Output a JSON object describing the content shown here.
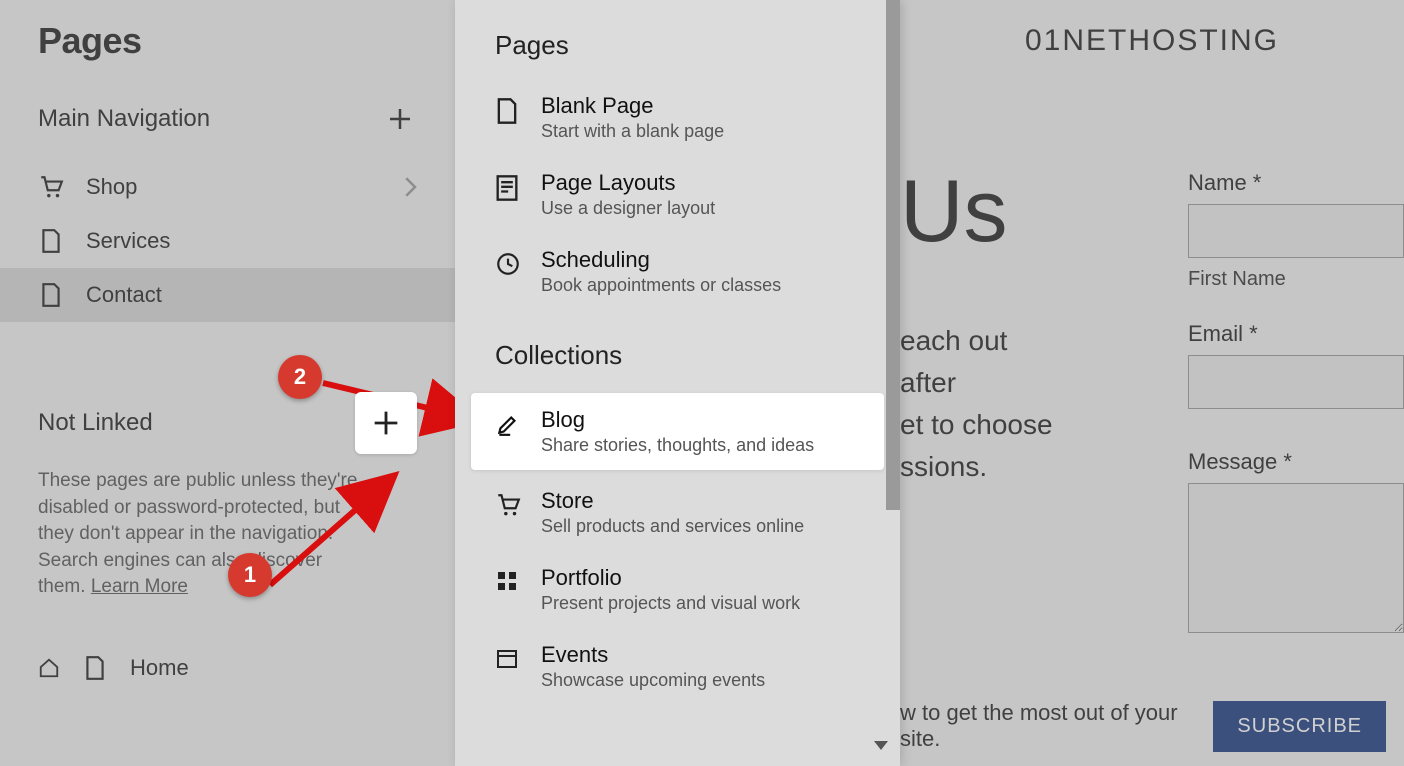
{
  "sidebar": {
    "title": "Pages",
    "main_nav_label": "Main Navigation",
    "nav_items": [
      {
        "label": "Shop"
      },
      {
        "label": "Services"
      },
      {
        "label": "Contact"
      }
    ],
    "not_linked_label": "Not Linked",
    "not_linked_desc_1": "These pages are public unless they're disabled or password-protected, but they don't appear in the navigation. Search engines can also discover them. ",
    "not_linked_learn": "Learn More",
    "home_label": "Home"
  },
  "popup": {
    "section_pages": "Pages",
    "section_collections": "Collections",
    "items_pages": [
      {
        "title": "Blank Page",
        "sub": "Start with a blank page"
      },
      {
        "title": "Page Layouts",
        "sub": "Use a designer layout"
      },
      {
        "title": "Scheduling",
        "sub": "Book appointments or classes"
      }
    ],
    "items_collections": [
      {
        "title": "Blog",
        "sub": "Share stories, thoughts, and ideas"
      },
      {
        "title": "Store",
        "sub": "Sell products and services online"
      },
      {
        "title": "Portfolio",
        "sub": "Present projects and visual work"
      },
      {
        "title": "Events",
        "sub": "Showcase upcoming events"
      }
    ]
  },
  "preview": {
    "brand": "01NETHOSTING",
    "hero_peek": "Us",
    "body_lines": "each out\nafter\net to choose\nssions.",
    "form": {
      "name_label": "Name *",
      "first_name_label": "First Name",
      "email_label": "Email *",
      "message_label": "Message *"
    },
    "bottom_text": "w to get the most out of your site.",
    "subscribe": "SUBSCRIBE"
  },
  "annotations": {
    "badge1": "1",
    "badge2": "2"
  }
}
